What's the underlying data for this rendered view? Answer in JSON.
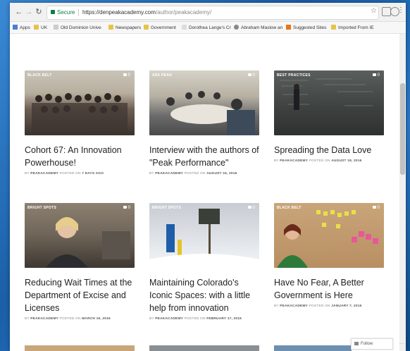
{
  "browser": {
    "secure_label": "Secure",
    "url_host": "https://denpeakacademy.com",
    "url_path": "/author/peakacademy/"
  },
  "bookmarks": [
    {
      "label": "Apps",
      "icon": "apps-icon"
    },
    {
      "label": "UK",
      "icon": "folder-icon"
    },
    {
      "label": "Old Dominion Unive",
      "icon": "bookmark-page-icon"
    },
    {
      "label": "Newspapers",
      "icon": "folder-icon"
    },
    {
      "label": "Government",
      "icon": "folder-icon"
    },
    {
      "label": "Dorothea Lange's Cr",
      "icon": "bookmark-page-icon"
    },
    {
      "label": "Abraham Maslow an",
      "icon": "bookmark-page-icon"
    },
    {
      "label": "Suggested Sites",
      "icon": "suggested-sites-icon"
    },
    {
      "label": "Imported From IE",
      "icon": "folder-icon"
    }
  ],
  "posts": [
    {
      "badge": "BLACK BELT",
      "comments": "0",
      "title": "Cohort 67: An Innovation Powerhouse!",
      "by_label": "BY",
      "author": "PEAKACADEMY",
      "posted_label": "POSTED ON",
      "date": "7 DAYS AGO"
    },
    {
      "badge": "ASK PEAK",
      "comments": "0",
      "title": "Interview with the authors of \"Peak Performance\"",
      "by_label": "BY",
      "author": "PEAKACADEMY",
      "posted_label": "POSTED ON",
      "date": "AUGUST 24, 2016"
    },
    {
      "badge": "BEST PRACTICES",
      "comments": "0",
      "title": "Spreading the Data Love",
      "by_label": "BY",
      "author": "PEAKACADEMY",
      "posted_label": "POSTED ON",
      "date": "AUGUST 18, 2016"
    },
    {
      "badge": "BRIGHT SPOTS",
      "comments": "0",
      "title": "Reducing Wait Times at the Department of Excise and Licenses",
      "by_label": "BY",
      "author": "PEAKACADEMY",
      "posted_label": "POSTED ON",
      "date": "MARCH 16, 2016"
    },
    {
      "badge": "BRIGHT SPOTS",
      "comments": "0",
      "title": "Maintaining Colorado's Iconic Spaces: with a little help from innovation",
      "by_label": "BY",
      "author": "PEAKACADEMY",
      "posted_label": "POSTED ON",
      "date": "FEBRUARY 17, 2016"
    },
    {
      "badge": "BLACK BELT",
      "comments": "0",
      "title": "Have No Fear, A Better Government is Here",
      "by_label": "BY",
      "author": "PEAKACADEMY",
      "posted_label": "POSTED ON",
      "date": "JANUARY 7, 2016"
    }
  ],
  "follow": {
    "label": "Follow",
    "more": "···"
  },
  "colors": {
    "link_title": "#222222",
    "meta": "#888888",
    "secure": "#0b8043"
  }
}
